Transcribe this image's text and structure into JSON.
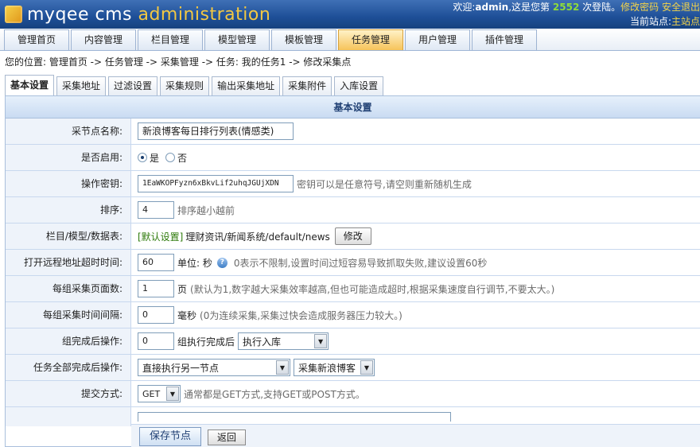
{
  "header": {
    "logo_text_a": "myqee cms",
    "logo_text_b": "administration",
    "welcome_prefix": "欢迎:",
    "username": "admin",
    "welcome_mid": ",这是您第",
    "login_count": "2552",
    "welcome_suffix": "次登陆。",
    "change_password": "修改密码",
    "safe_logout": "安全退出",
    "current_site_label": "当前站点:",
    "current_site": "主站点"
  },
  "main_nav": [
    {
      "label": "管理首页",
      "active": false
    },
    {
      "label": "内容管理",
      "active": false
    },
    {
      "label": "栏目管理",
      "active": false
    },
    {
      "label": "模型管理",
      "active": false
    },
    {
      "label": "模板管理",
      "active": false
    },
    {
      "label": "任务管理",
      "active": true
    },
    {
      "label": "用户管理",
      "active": false
    },
    {
      "label": "插件管理",
      "active": false
    }
  ],
  "breadcrumb": "您的位置: 管理首页 -> 任务管理 -> 采集管理 -> 任务: 我的任务1 -> 修改采集点",
  "sub_tabs": [
    {
      "label": "基本设置",
      "active": true
    },
    {
      "label": "采集地址",
      "active": false
    },
    {
      "label": "过滤设置",
      "active": false
    },
    {
      "label": "采集规则",
      "active": false
    },
    {
      "label": "输出采集地址",
      "active": false
    },
    {
      "label": "采集附件",
      "active": false
    },
    {
      "label": "入库设置",
      "active": false
    }
  ],
  "panel": {
    "title": "基本设置",
    "rows": {
      "node_name": {
        "label": "采节点名称:",
        "value": "新浪博客每日排行列表(情感类)"
      },
      "enabled": {
        "label": "是否启用:",
        "yes": "是",
        "no": "否",
        "selected": "yes"
      },
      "secret": {
        "label": "操作密钥:",
        "value": "1EaWKOPFyzn6xBkvLif2uhqJGUjXDN",
        "tip": "密钥可以是任意符号,请空则重新随机生成"
      },
      "sort": {
        "label": "排序:",
        "value": "4",
        "tip": "排序越小越前"
      },
      "column": {
        "label": "栏目/模型/数据表:",
        "default_tag": "[默认设置]",
        "path": "理财资讯/新闻系统/default/news",
        "button": "修改"
      },
      "timeout": {
        "label": "打开远程地址超时时间:",
        "value": "60",
        "unit": "单位: 秒",
        "help": "?",
        "tip": "0表示不限制,设置时间过短容易导致抓取失败,建议设置60秒"
      },
      "pages_per_group": {
        "label": "每组采集页面数:",
        "value": "1",
        "unit": "页",
        "tip": "(默认为1,数字越大采集效率越高,但也可能造成超时,根据采集速度自行调节,不要太大。)"
      },
      "interval": {
        "label": "每组采集时间间隔:",
        "value": "0",
        "unit": "毫秒",
        "tip": "(0为连续采集,采集过快会造成服务器压力较大。)"
      },
      "after_group": {
        "label": "组完成后操作:",
        "value": "0",
        "mid": "组执行完成后",
        "select": "执行入库"
      },
      "after_all": {
        "label": "任务全部完成后操作:",
        "select1": "直接执行另一节点",
        "select2": "采集新浪博客"
      },
      "submit_method": {
        "label": "提交方式:",
        "select": "GET",
        "tip": "通常都是GET方式,支持GET或POST方式。"
      }
    },
    "save_button": "保存节点",
    "back_button": "返回"
  }
}
